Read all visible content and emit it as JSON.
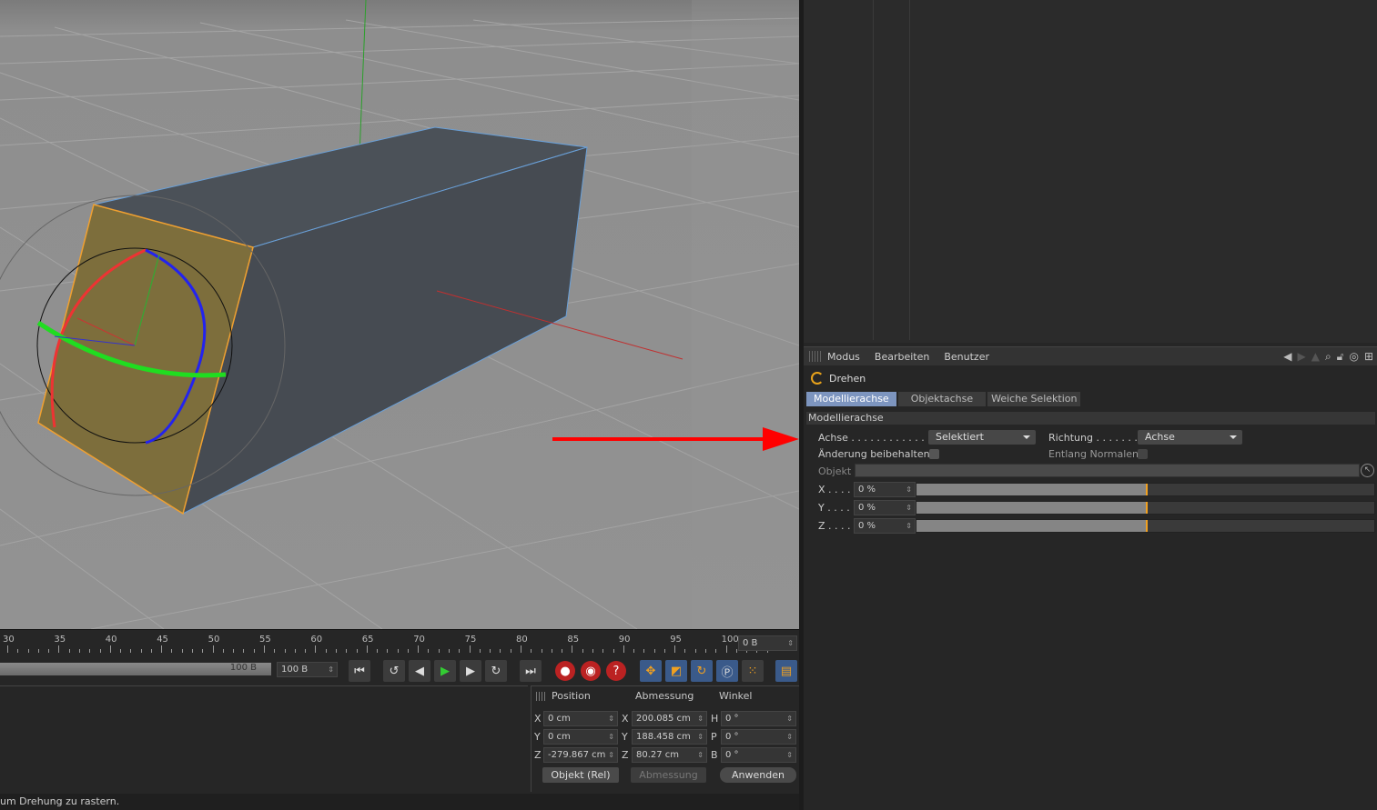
{
  "attr_menu": {
    "items": [
      "Modus",
      "Bearbeiten",
      "Benutzer"
    ]
  },
  "tool": {
    "name": "Drehen"
  },
  "tabs": [
    "Modellierachse",
    "Objektachse",
    "Weiche Selektion"
  ],
  "section": "Modellierachse",
  "achse": {
    "label": "Achse . . . . . . . . . . . . . . .",
    "value": "Selektiert"
  },
  "richtung": {
    "label": "Richtung . . . . . . .",
    "value": "Achse"
  },
  "aenderung": {
    "label": "Änderung beibehalten"
  },
  "entlang": {
    "label": "Entlang Normalen"
  },
  "objekt": {
    "label": "Objekt"
  },
  "axes": [
    {
      "label": "X . . . . .",
      "value": "0 %",
      "fill": 0.5
    },
    {
      "label": "Y . . . . .",
      "value": "0 %",
      "fill": 0.5
    },
    {
      "label": "Z . . . . .",
      "value": "0 %",
      "fill": 0.5
    }
  ],
  "timeline": {
    "ticks": [
      "30",
      "35",
      "40",
      "45",
      "50",
      "55",
      "60",
      "65",
      "70",
      "75",
      "80",
      "85",
      "90",
      "95",
      "100"
    ],
    "current": "0 B",
    "end_label": "100 B",
    "end_field": "100 B"
  },
  "coords": {
    "headers": [
      "Position",
      "Abmessung",
      "Winkel"
    ],
    "rows": [
      {
        "pos_axis": "X",
        "pos": "0 cm",
        "size_axis": "X",
        "size": "200.085 cm",
        "rot_axis": "H",
        "rot": "0 °"
      },
      {
        "pos_axis": "Y",
        "pos": "0 cm",
        "size_axis": "Y",
        "size": "188.458 cm",
        "rot_axis": "P",
        "rot": "0 °"
      },
      {
        "pos_axis": "Z",
        "pos": "-279.867 cm",
        "size_axis": "Z",
        "size": "80.27 cm",
        "rot_axis": "B",
        "rot": "0 °"
      }
    ],
    "mode": "Objekt (Rel)",
    "size_mode": "Abmessung",
    "apply": "Anwenden"
  },
  "status": "um Drehung zu rastern.",
  "colors": {
    "accent": "#f0a020",
    "tab_active": "#7d95bf",
    "arrow": "#ff0000"
  }
}
